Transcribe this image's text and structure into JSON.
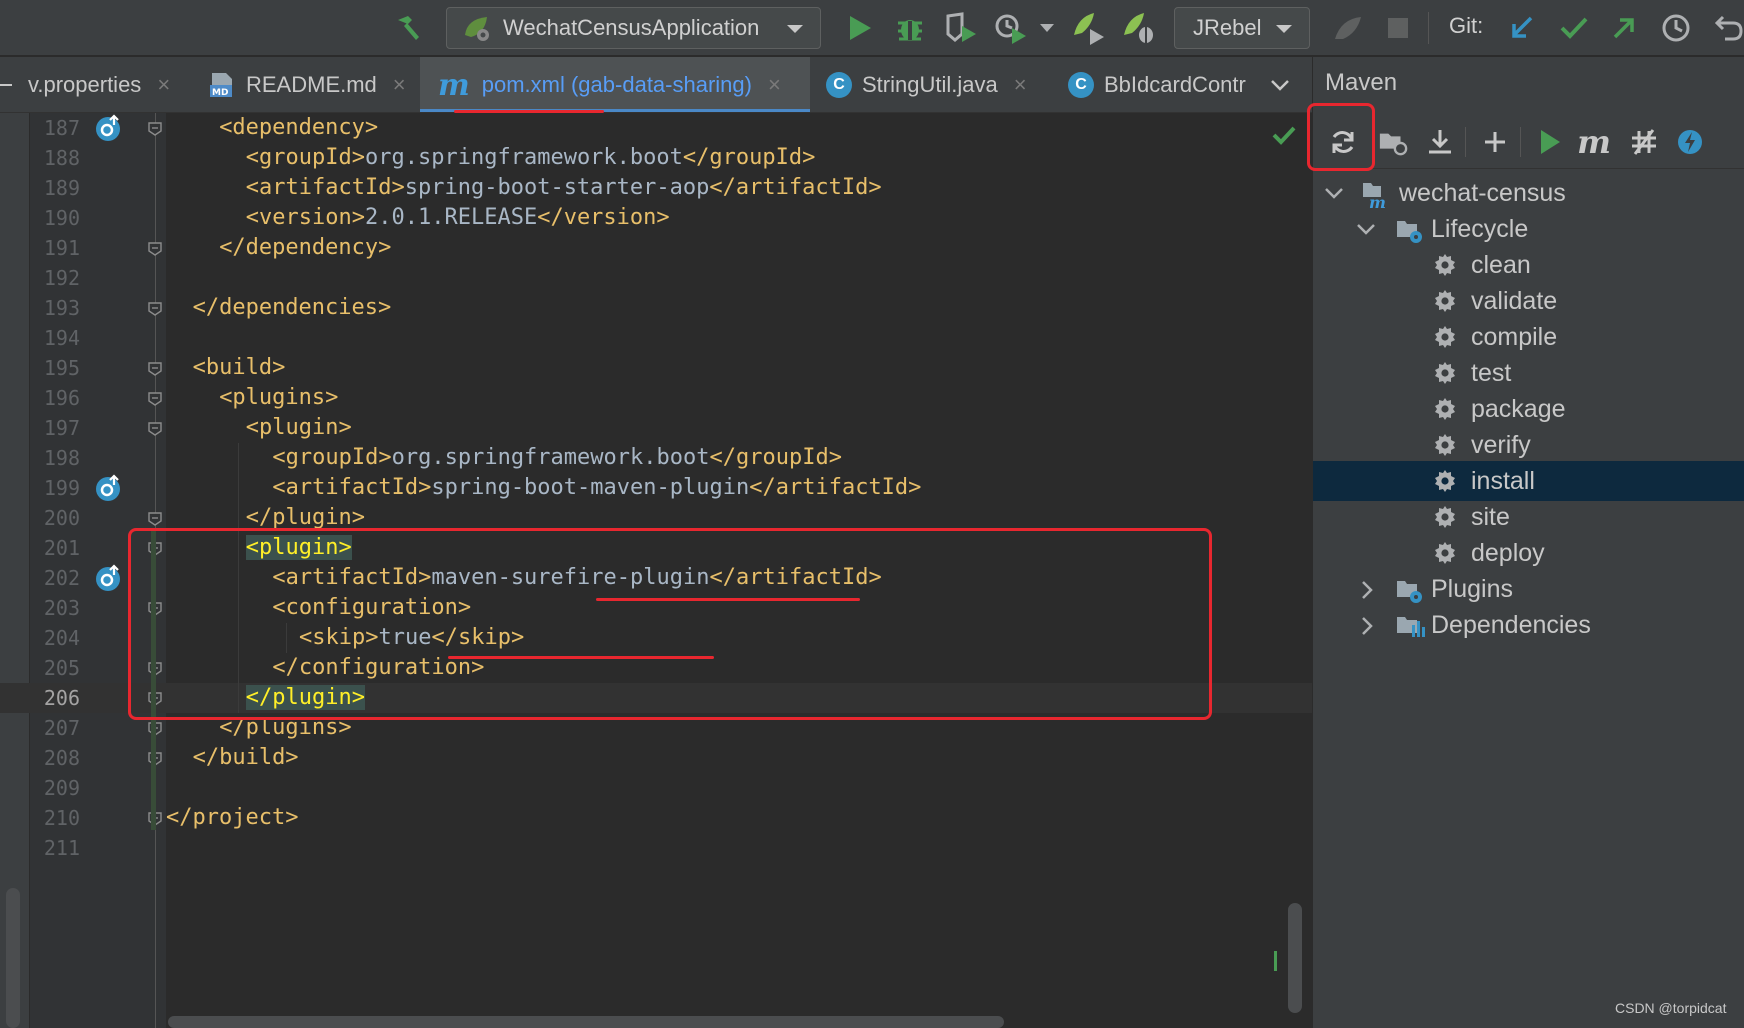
{
  "toolbar": {
    "run_config": "WechatCensusApplication",
    "jrebel": "JRebel",
    "git_label": "Git:"
  },
  "tabs": [
    {
      "label": "v.properties",
      "close": "×"
    },
    {
      "label": "README.md",
      "close": "×"
    },
    {
      "label": "pom.xml (gab-data-sharing)",
      "close": "×"
    },
    {
      "label": "StringUtil.java",
      "close": "×"
    },
    {
      "label": "BbIdcardContr"
    }
  ],
  "editor": {
    "lines": [
      {
        "n": "187",
        "parts": [
          {
            "c": "tag",
            "t": "<dependency>"
          }
        ]
      },
      {
        "n": "188",
        "parts": [
          {
            "c": "tag",
            "t": "<groupId>"
          },
          {
            "c": "txt",
            "t": "org.springframework.boot"
          },
          {
            "c": "tag",
            "t": "</groupId>"
          }
        ]
      },
      {
        "n": "189",
        "parts": [
          {
            "c": "tag",
            "t": "<artifactId>"
          },
          {
            "c": "txt",
            "t": "spring-boot-starter-aop"
          },
          {
            "c": "tag",
            "t": "</artifactId>"
          }
        ]
      },
      {
        "n": "190",
        "parts": [
          {
            "c": "tag",
            "t": "<version>"
          },
          {
            "c": "txt",
            "t": "2.0.1.RELEASE"
          },
          {
            "c": "tag",
            "t": "</version>"
          }
        ]
      },
      {
        "n": "191",
        "parts": [
          {
            "c": "tag",
            "t": "</dependency>"
          }
        ]
      },
      {
        "n": "192",
        "parts": []
      },
      {
        "n": "193",
        "parts": [
          {
            "c": "tag",
            "t": "</dependencies>"
          }
        ]
      },
      {
        "n": "194",
        "parts": []
      },
      {
        "n": "195",
        "parts": [
          {
            "c": "tag",
            "t": "<build>"
          }
        ]
      },
      {
        "n": "196",
        "parts": [
          {
            "c": "tag",
            "t": "<plugins>"
          }
        ]
      },
      {
        "n": "197",
        "parts": [
          {
            "c": "tag",
            "t": "<plugin>"
          }
        ]
      },
      {
        "n": "198",
        "parts": [
          {
            "c": "tag",
            "t": "<groupId>"
          },
          {
            "c": "txt",
            "t": "org.springframework.boot"
          },
          {
            "c": "tag",
            "t": "</groupId>"
          }
        ]
      },
      {
        "n": "199",
        "parts": [
          {
            "c": "tag",
            "t": "<artifactId>"
          },
          {
            "c": "txt",
            "t": "spring-boot-maven-plugin"
          },
          {
            "c": "tag",
            "t": "</artifactId>"
          }
        ]
      },
      {
        "n": "200",
        "parts": [
          {
            "c": "tag",
            "t": "</plugin>"
          }
        ]
      },
      {
        "n": "201",
        "parts": [
          {
            "c": "hl-tag",
            "t": "<plugin>"
          }
        ]
      },
      {
        "n": "202",
        "parts": [
          {
            "c": "tag",
            "t": "<artifactId>"
          },
          {
            "c": "txt",
            "t": "maven-surefire-plugin"
          },
          {
            "c": "tag",
            "t": "</artifactId>"
          }
        ]
      },
      {
        "n": "203",
        "parts": [
          {
            "c": "tag",
            "t": "<configuration>"
          }
        ]
      },
      {
        "n": "204",
        "parts": [
          {
            "c": "tag",
            "t": "<skip>"
          },
          {
            "c": "txt",
            "t": "true"
          },
          {
            "c": "tag",
            "t": "</skip>"
          }
        ]
      },
      {
        "n": "205",
        "parts": [
          {
            "c": "tag",
            "t": "</configuration>"
          }
        ]
      },
      {
        "n": "206",
        "parts": [
          {
            "c": "hl-tag",
            "t": "</plugin>"
          }
        ]
      },
      {
        "n": "207",
        "parts": [
          {
            "c": "tag",
            "t": "</plugins>"
          }
        ]
      },
      {
        "n": "208",
        "parts": [
          {
            "c": "tag",
            "t": "</build>"
          }
        ]
      },
      {
        "n": "209",
        "parts": []
      },
      {
        "n": "210",
        "parts": [
          {
            "c": "tag",
            "t": "</project>"
          }
        ]
      },
      {
        "n": "211",
        "parts": []
      }
    ]
  },
  "maven": {
    "title": "Maven",
    "project": "wechat-census",
    "lifecycle_label": "Lifecycle",
    "goals": [
      "clean",
      "validate",
      "compile",
      "test",
      "package",
      "verify",
      "install",
      "site",
      "deploy"
    ],
    "selected_goal": "install",
    "plugins_label": "Plugins",
    "dependencies_label": "Dependencies"
  },
  "watermark": "CSDN @torpidcat"
}
